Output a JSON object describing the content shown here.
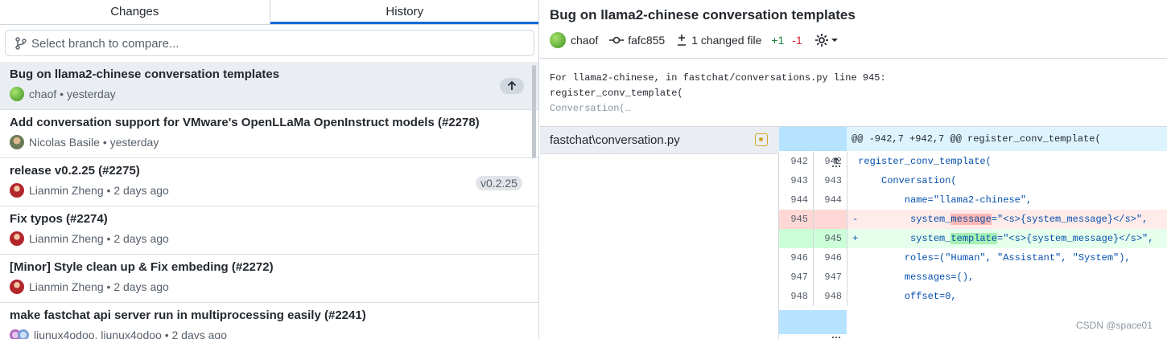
{
  "tabs": {
    "changes": "Changes",
    "history": "History"
  },
  "branch_compare": {
    "placeholder": "Select branch to compare..."
  },
  "commits": [
    {
      "title": "Bug on llama2-chinese conversation templates",
      "author": "chaof",
      "time": "yesterday",
      "badge": "push-arrow"
    },
    {
      "title": "Add conversation support for VMware's OpenLLaMa OpenInstruct models (#2278)",
      "author": "Nicolas Basile",
      "time": "yesterday"
    },
    {
      "title": "release v0.2.25 (#2275)",
      "author": "Lianmin Zheng",
      "time": "2 days ago",
      "tag": "v0.2.25"
    },
    {
      "title": "Fix typos (#2274)",
      "author": "Lianmin Zheng",
      "time": "2 days ago"
    },
    {
      "title": "[Minor] Style clean up & Fix embeding (#2272)",
      "author": "Lianmin Zheng",
      "time": "2 days ago"
    },
    {
      "title": "make fastchat api server run in multiprocessing easily (#2241)",
      "author": "liunux4odoo, liunux4odoo",
      "time": "2 days ago"
    }
  ],
  "detail": {
    "title": "Bug on llama2-chinese conversation templates",
    "author": "chaof",
    "sha": "fafc855",
    "changed": "1 changed file",
    "additions": "+1",
    "deletions": "-1",
    "description": [
      "For llama2-chinese, in fastchat/conversations.py line 945:",
      "register_conv_template(",
      "Conversation(…"
    ]
  },
  "files": [
    {
      "name": "fastchat\\conversation.py",
      "status": "modified"
    }
  ],
  "diff": {
    "hunk": "@@ -942,7 +942,7 @@ register_conv_template(",
    "lines": [
      {
        "old": "942",
        "new": "942",
        "text": " register_conv_template("
      },
      {
        "old": "943",
        "new": "943",
        "text": "     Conversation("
      },
      {
        "old": "944",
        "new": "944",
        "text": "         name=\"llama2-chinese\","
      },
      {
        "old": "945",
        "new": "",
        "prefix": "-",
        "pre": "         system_",
        "hl": "message",
        "post": "=\"<s>{system_message}</s>\","
      },
      {
        "old": "",
        "new": "945",
        "prefix": "+",
        "pre": "         system_",
        "hl": "template",
        "post": "=\"<s>{system_message}</s>\","
      },
      {
        "old": "946",
        "new": "946",
        "text": "         roles=(\"Human\", \"Assistant\", \"System\"),"
      },
      {
        "old": "947",
        "new": "947",
        "text": "         messages=(),"
      },
      {
        "old": "948",
        "new": "948",
        "text": "         offset=0,"
      }
    ]
  },
  "watermark": "CSDN @space01",
  "colors": {
    "accent": "#0969da",
    "added": "#1a7f37",
    "removed": "#cf222e",
    "modified": "#d4a72c"
  }
}
